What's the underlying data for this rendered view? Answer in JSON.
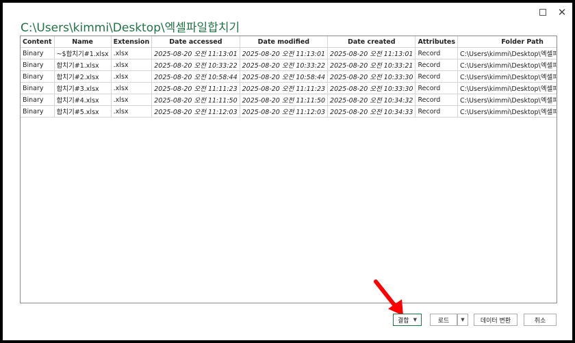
{
  "window": {
    "title": "C:\\Users\\kimmi\\Desktop\\엑셀파일합치기",
    "maximize_icon": "maximize-icon",
    "close_icon": "close-icon"
  },
  "table": {
    "columns": [
      "Content",
      "Name",
      "Extension",
      "Date accessed",
      "Date modified",
      "Date created",
      "Attributes",
      "Folder Path"
    ],
    "rows": [
      {
        "content": "Binary",
        "name": "~$합치기#1.xlsx",
        "extension": ".xlsx",
        "accessed": "2025-08-20 오전 11:13:01",
        "modified": "2025-08-20 오전 11:13:01",
        "created": "2025-08-20 오전 11:13:01",
        "attributes": "Record",
        "folder": "C:\\Users\\kimmi\\Desktop\\엑셀파일합치기\\"
      },
      {
        "content": "Binary",
        "name": "합치기#1.xlsx",
        "extension": ".xlsx",
        "accessed": "2025-08-20 오전 10:33:22",
        "modified": "2025-08-20 오전 10:33:22",
        "created": "2025-08-20 오전 10:33:21",
        "attributes": "Record",
        "folder": "C:\\Users\\kimmi\\Desktop\\엑셀파일합치기\\"
      },
      {
        "content": "Binary",
        "name": "합치기#2.xlsx",
        "extension": ".xlsx",
        "accessed": "2025-08-20 오전 10:58:44",
        "modified": "2025-08-20 오전 10:58:44",
        "created": "2025-08-20 오전 10:33:30",
        "attributes": "Record",
        "folder": "C:\\Users\\kimmi\\Desktop\\엑셀파일합치기\\"
      },
      {
        "content": "Binary",
        "name": "합치기#3.xlsx",
        "extension": ".xlsx",
        "accessed": "2025-08-20 오전 11:11:23",
        "modified": "2025-08-20 오전 11:11:23",
        "created": "2025-08-20 오전 10:33:30",
        "attributes": "Record",
        "folder": "C:\\Users\\kimmi\\Desktop\\엑셀파일합치기\\"
      },
      {
        "content": "Binary",
        "name": "합치기#4.xlsx",
        "extension": ".xlsx",
        "accessed": "2025-08-20 오전 11:11:50",
        "modified": "2025-08-20 오전 11:11:50",
        "created": "2025-08-20 오전 10:34:32",
        "attributes": "Record",
        "folder": "C:\\Users\\kimmi\\Desktop\\엑셀파일합치기\\"
      },
      {
        "content": "Binary",
        "name": "합치기#5.xlsx",
        "extension": ".xlsx",
        "accessed": "2025-08-20 오전 11:12:03",
        "modified": "2025-08-20 오전 11:12:03",
        "created": "2025-08-20 오전 10:34:33",
        "attributes": "Record",
        "folder": "C:\\Users\\kimmi\\Desktop\\엑셀파일합치기\\"
      }
    ]
  },
  "buttons": {
    "combine": "결합",
    "load": "로드",
    "transform": "데이터 변환",
    "cancel": "취소",
    "dropdown_icon": "dropdown-arrow-icon"
  },
  "annotation": {
    "arrow_color": "#ff0000"
  },
  "colors": {
    "title": "#217346",
    "accent_border": "#217346"
  }
}
